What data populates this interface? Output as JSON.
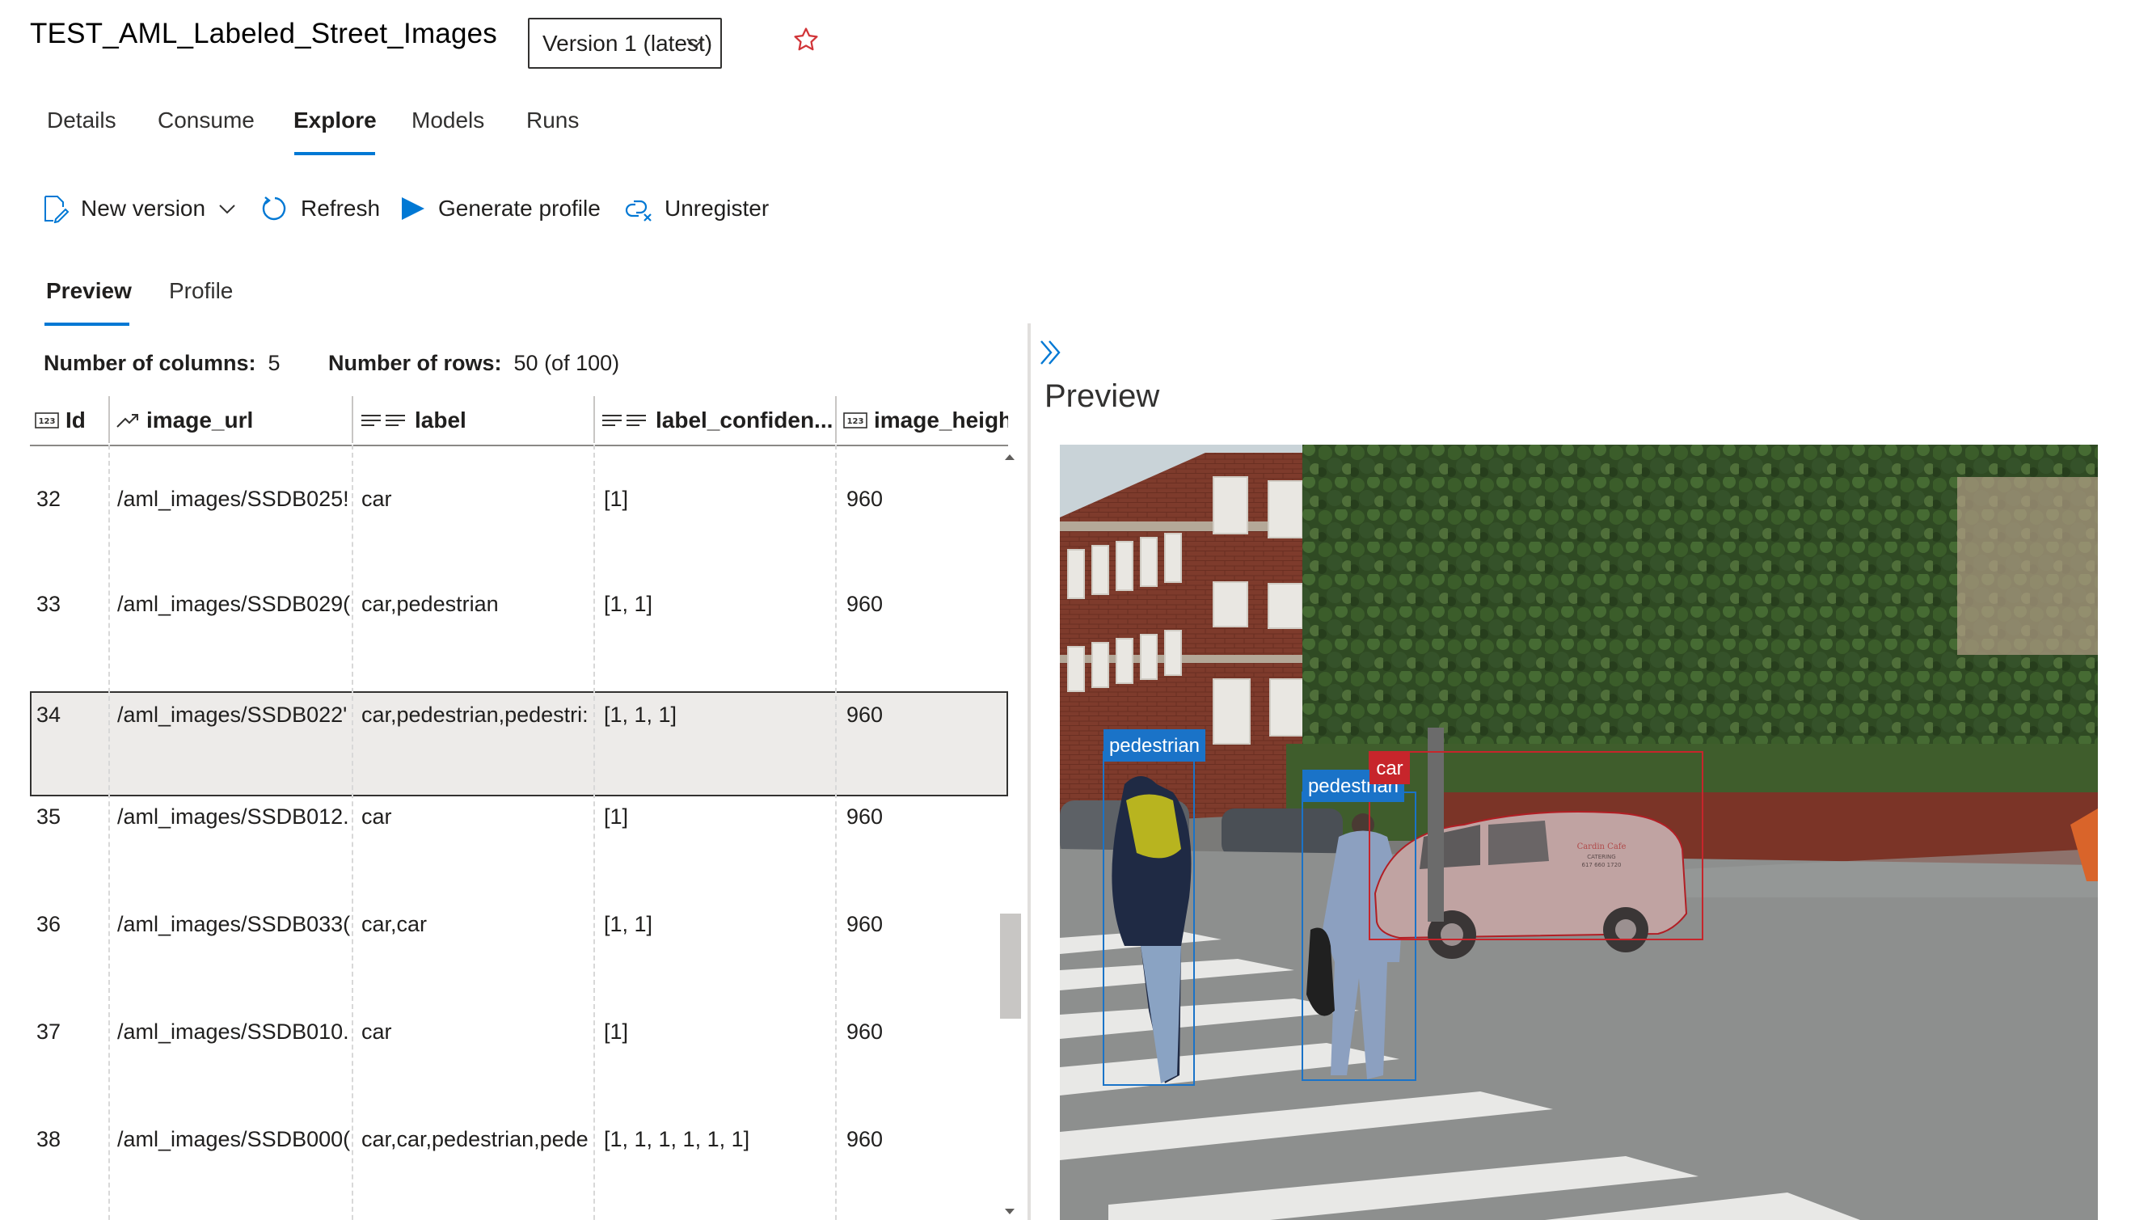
{
  "header": {
    "title": "TEST_AML_Labeled_Street_Images",
    "version": "Version 1 (latest)"
  },
  "tabs": [
    "Details",
    "Consume",
    "Explore",
    "Models",
    "Runs"
  ],
  "active_tab": "Explore",
  "toolbar": {
    "new_version": "New version",
    "refresh": "Refresh",
    "generate_profile": "Generate profile",
    "unregister": "Unregister"
  },
  "subtabs": [
    "Preview",
    "Profile"
  ],
  "stats": {
    "columns_label": "Number of columns:",
    "columns_value": "5",
    "rows_label": "Number of rows:",
    "rows_value": "50 (of 100)"
  },
  "grid": {
    "columns": [
      "Id",
      "image_url",
      "label",
      "label_confiden...",
      "image_heigh"
    ],
    "rows": [
      [
        "32",
        "/aml_images/SSDB025!",
        "car",
        "[1]",
        "960"
      ],
      [
        "33",
        "/aml_images/SSDB029(",
        "car,pedestrian",
        "[1, 1]",
        "960"
      ],
      [
        "34",
        "/aml_images/SSDB022'",
        "car,pedestrian,pedestri:",
        "[1, 1, 1]",
        "960"
      ],
      [
        "35",
        "/aml_images/SSDB012.",
        "car",
        "[1]",
        "960"
      ],
      [
        "36",
        "/aml_images/SSDB033(",
        "car,car",
        "[1, 1]",
        "960"
      ],
      [
        "37",
        "/aml_images/SSDB010.",
        "car",
        "[1]",
        "960"
      ],
      [
        "38",
        "/aml_images/SSDB000(",
        "car,car,pedestrian,pede",
        "[1, 1, 1, 1, 1, 1]",
        "960"
      ]
    ],
    "selected_row": "34"
  },
  "preview": {
    "title": "Preview",
    "labels": {
      "pedestrian1": "pedestrian",
      "pedestrian2": "pedestrian",
      "car": "car"
    },
    "van_text": {
      "line1": "Cardin Cafe",
      "line2": "CATERING",
      "line3": "617 660 1720"
    }
  },
  "colors": {
    "accent": "#0078d4",
    "pedestrian_box": "#1a73c8",
    "car_box": "#c7252b",
    "star": "#d13438"
  },
  "icons": [
    "dataset-edit-icon",
    "chevron-down-icon",
    "refresh-icon",
    "play-icon",
    "unregister-icon",
    "star-icon",
    "numeric-type-icon",
    "url-type-icon",
    "text-type-icon",
    "double-chevron-right-icon"
  ]
}
